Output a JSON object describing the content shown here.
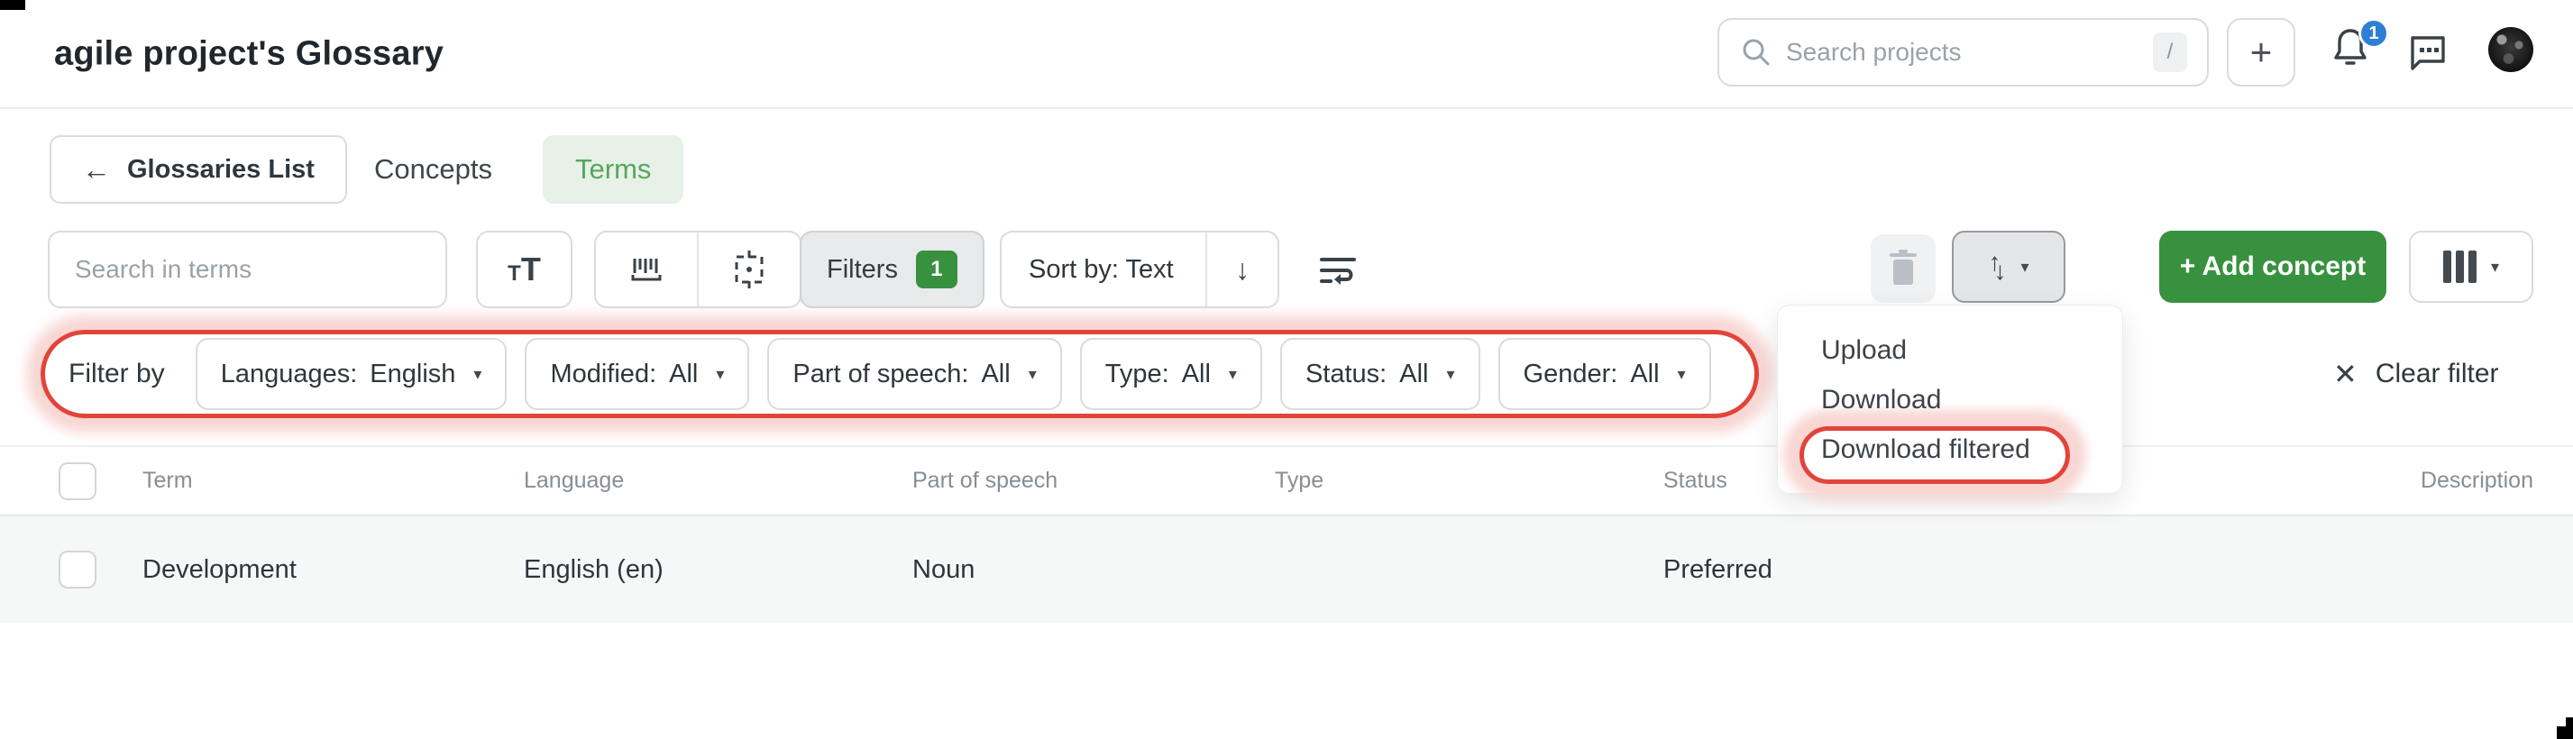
{
  "header": {
    "title": "agile project's Glossary",
    "search_placeholder": "Search projects",
    "search_shortcut": "/",
    "notification_count": "1"
  },
  "nav": {
    "back_label": "Glossaries List",
    "tab_concepts": "Concepts",
    "tab_terms": "Terms"
  },
  "toolbar": {
    "search_placeholder": "Search in terms",
    "filters_label": "Filters",
    "filters_count": "1",
    "sort_label": "Sort by: Text",
    "sort_direction_icon": "arrow-down",
    "add_concept_label": "+ Add concept"
  },
  "filter_bar": {
    "label": "Filter by",
    "filters": [
      {
        "label": "Languages:",
        "value": "English"
      },
      {
        "label": "Modified:",
        "value": "All"
      },
      {
        "label": "Part of speech:",
        "value": "All"
      },
      {
        "label": "Type:",
        "value": "All"
      },
      {
        "label": "Status:",
        "value": "All"
      },
      {
        "label": "Gender:",
        "value": "All"
      }
    ],
    "clear_label": "Clear filter"
  },
  "menu": {
    "items": [
      "Upload",
      "Download",
      "Download filtered"
    ],
    "highlighted_item": "Download filtered"
  },
  "table": {
    "columns": [
      "Term",
      "Language",
      "Part of speech",
      "Type",
      "Status",
      "Description"
    ],
    "rows": [
      {
        "term": "Development",
        "language": "English (en)",
        "part_of_speech": "Noun",
        "type": "",
        "status": "Preferred",
        "description": ""
      }
    ]
  },
  "colors": {
    "accent_green": "#38913f",
    "green_tab_bg": "#e7f1e7",
    "green_tab_text": "#57a75c",
    "badge_blue": "#2e7ed4",
    "annotation_red": "#e2443a",
    "annotation_glow": "#f8d6d3"
  }
}
